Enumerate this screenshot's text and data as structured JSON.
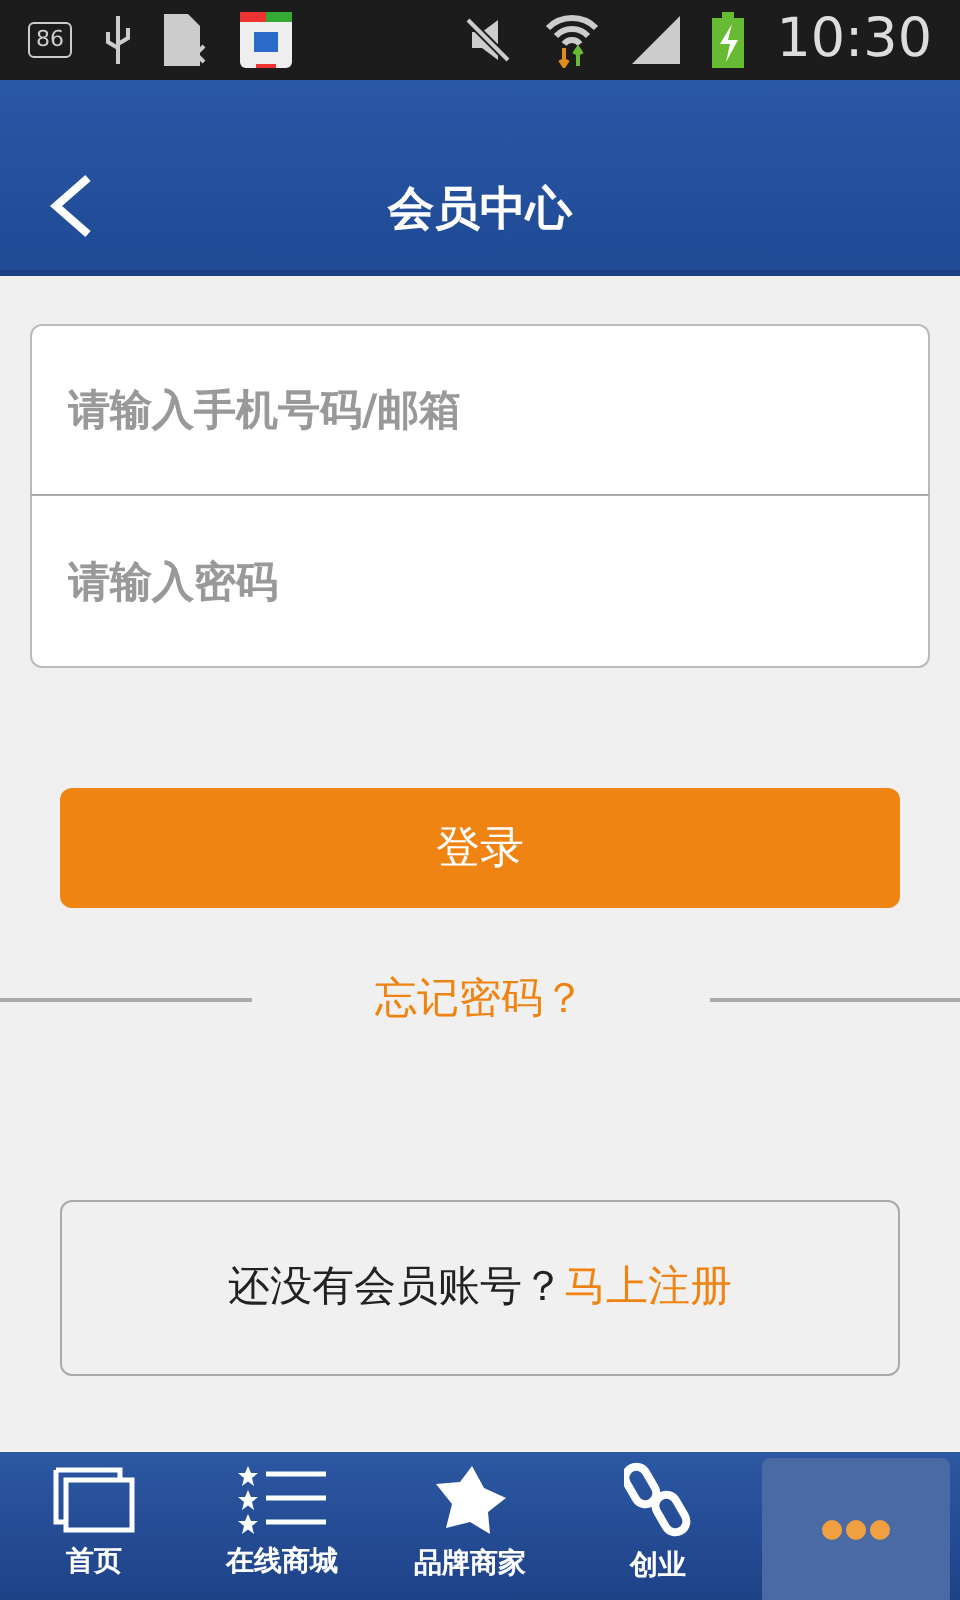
{
  "status_bar": {
    "notification_badge": "86",
    "time": "10:30"
  },
  "header": {
    "title": "会员中心"
  },
  "form": {
    "fields": [
      {
        "placeholder": "请输入手机号码/邮箱"
      },
      {
        "placeholder": "请输入密码"
      }
    ],
    "login_button": "登录",
    "forgot_link": "忘记密码？"
  },
  "register_prompt": {
    "text": "还没有会员账号？",
    "link": "马上注册"
  },
  "tab_bar": [
    {
      "label": "首页",
      "selected": false
    },
    {
      "label": "在线商城",
      "selected": false
    },
    {
      "label": "品牌商家",
      "selected": false
    },
    {
      "label": "创业",
      "selected": false
    },
    {
      "selected": true
    }
  ]
}
